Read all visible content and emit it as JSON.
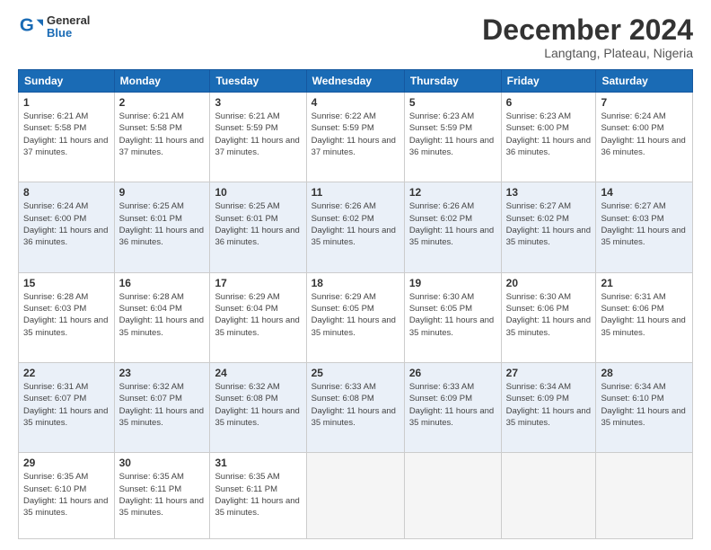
{
  "logo": {
    "general": "General",
    "blue": "Blue"
  },
  "header": {
    "month": "December 2024",
    "location": "Langtang, Plateau, Nigeria"
  },
  "weekdays": [
    "Sunday",
    "Monday",
    "Tuesday",
    "Wednesday",
    "Thursday",
    "Friday",
    "Saturday"
  ],
  "weeks": [
    [
      {
        "day": "1",
        "sunrise": "6:21 AM",
        "sunset": "5:58 PM",
        "daylight": "11 hours and 37 minutes."
      },
      {
        "day": "2",
        "sunrise": "6:21 AM",
        "sunset": "5:58 PM",
        "daylight": "11 hours and 37 minutes."
      },
      {
        "day": "3",
        "sunrise": "6:21 AM",
        "sunset": "5:59 PM",
        "daylight": "11 hours and 37 minutes."
      },
      {
        "day": "4",
        "sunrise": "6:22 AM",
        "sunset": "5:59 PM",
        "daylight": "11 hours and 37 minutes."
      },
      {
        "day": "5",
        "sunrise": "6:23 AM",
        "sunset": "5:59 PM",
        "daylight": "11 hours and 36 minutes."
      },
      {
        "day": "6",
        "sunrise": "6:23 AM",
        "sunset": "6:00 PM",
        "daylight": "11 hours and 36 minutes."
      },
      {
        "day": "7",
        "sunrise": "6:24 AM",
        "sunset": "6:00 PM",
        "daylight": "11 hours and 36 minutes."
      }
    ],
    [
      {
        "day": "8",
        "sunrise": "6:24 AM",
        "sunset": "6:00 PM",
        "daylight": "11 hours and 36 minutes."
      },
      {
        "day": "9",
        "sunrise": "6:25 AM",
        "sunset": "6:01 PM",
        "daylight": "11 hours and 36 minutes."
      },
      {
        "day": "10",
        "sunrise": "6:25 AM",
        "sunset": "6:01 PM",
        "daylight": "11 hours and 36 minutes."
      },
      {
        "day": "11",
        "sunrise": "6:26 AM",
        "sunset": "6:02 PM",
        "daylight": "11 hours and 35 minutes."
      },
      {
        "day": "12",
        "sunrise": "6:26 AM",
        "sunset": "6:02 PM",
        "daylight": "11 hours and 35 minutes."
      },
      {
        "day": "13",
        "sunrise": "6:27 AM",
        "sunset": "6:02 PM",
        "daylight": "11 hours and 35 minutes."
      },
      {
        "day": "14",
        "sunrise": "6:27 AM",
        "sunset": "6:03 PM",
        "daylight": "11 hours and 35 minutes."
      }
    ],
    [
      {
        "day": "15",
        "sunrise": "6:28 AM",
        "sunset": "6:03 PM",
        "daylight": "11 hours and 35 minutes."
      },
      {
        "day": "16",
        "sunrise": "6:28 AM",
        "sunset": "6:04 PM",
        "daylight": "11 hours and 35 minutes."
      },
      {
        "day": "17",
        "sunrise": "6:29 AM",
        "sunset": "6:04 PM",
        "daylight": "11 hours and 35 minutes."
      },
      {
        "day": "18",
        "sunrise": "6:29 AM",
        "sunset": "6:05 PM",
        "daylight": "11 hours and 35 minutes."
      },
      {
        "day": "19",
        "sunrise": "6:30 AM",
        "sunset": "6:05 PM",
        "daylight": "11 hours and 35 minutes."
      },
      {
        "day": "20",
        "sunrise": "6:30 AM",
        "sunset": "6:06 PM",
        "daylight": "11 hours and 35 minutes."
      },
      {
        "day": "21",
        "sunrise": "6:31 AM",
        "sunset": "6:06 PM",
        "daylight": "11 hours and 35 minutes."
      }
    ],
    [
      {
        "day": "22",
        "sunrise": "6:31 AM",
        "sunset": "6:07 PM",
        "daylight": "11 hours and 35 minutes."
      },
      {
        "day": "23",
        "sunrise": "6:32 AM",
        "sunset": "6:07 PM",
        "daylight": "11 hours and 35 minutes."
      },
      {
        "day": "24",
        "sunrise": "6:32 AM",
        "sunset": "6:08 PM",
        "daylight": "11 hours and 35 minutes."
      },
      {
        "day": "25",
        "sunrise": "6:33 AM",
        "sunset": "6:08 PM",
        "daylight": "11 hours and 35 minutes."
      },
      {
        "day": "26",
        "sunrise": "6:33 AM",
        "sunset": "6:09 PM",
        "daylight": "11 hours and 35 minutes."
      },
      {
        "day": "27",
        "sunrise": "6:34 AM",
        "sunset": "6:09 PM",
        "daylight": "11 hours and 35 minutes."
      },
      {
        "day": "28",
        "sunrise": "6:34 AM",
        "sunset": "6:10 PM",
        "daylight": "11 hours and 35 minutes."
      }
    ],
    [
      {
        "day": "29",
        "sunrise": "6:35 AM",
        "sunset": "6:10 PM",
        "daylight": "11 hours and 35 minutes."
      },
      {
        "day": "30",
        "sunrise": "6:35 AM",
        "sunset": "6:11 PM",
        "daylight": "11 hours and 35 minutes."
      },
      {
        "day": "31",
        "sunrise": "6:35 AM",
        "sunset": "6:11 PM",
        "daylight": "11 hours and 35 minutes."
      },
      null,
      null,
      null,
      null
    ]
  ]
}
